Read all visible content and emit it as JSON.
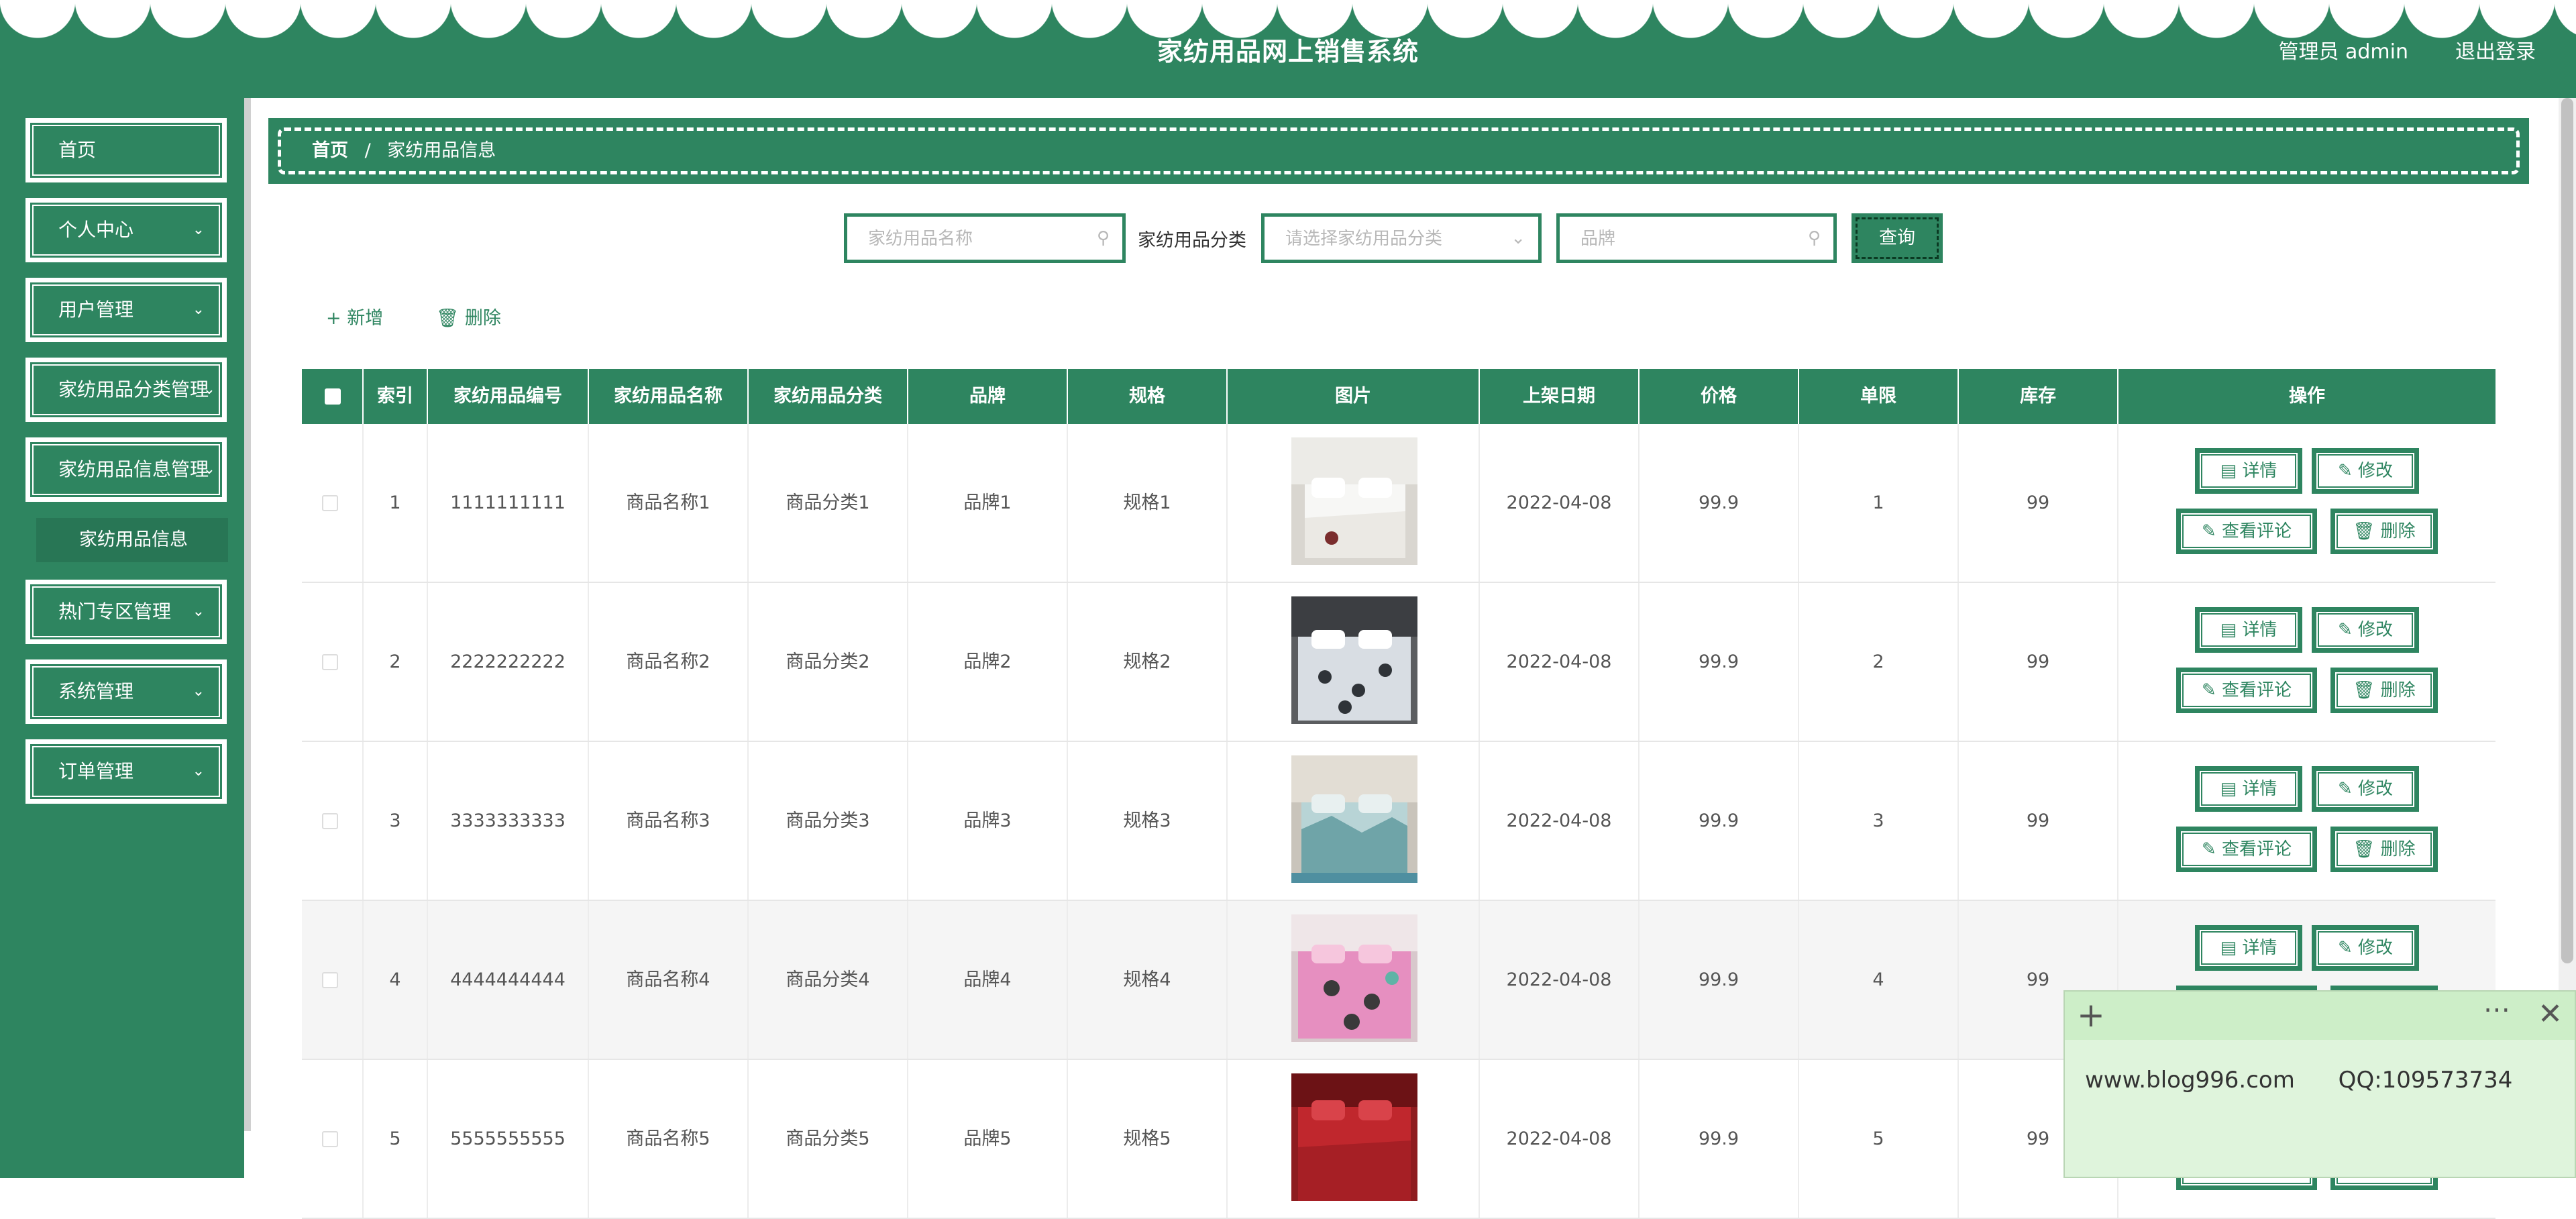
{
  "header": {
    "title": "家纺用品网上销售系统",
    "admin_label": "管理员 admin",
    "logout": "退出登录"
  },
  "sidebar": {
    "items": [
      {
        "label": "首页",
        "has_arrow": false
      },
      {
        "label": "个人中心",
        "has_arrow": true
      },
      {
        "label": "用户管理",
        "has_arrow": true
      },
      {
        "label": "家纺用品分类管理",
        "has_arrow": true
      },
      {
        "label": "家纺用品信息管理",
        "has_arrow": true
      },
      {
        "label": "热门专区管理",
        "has_arrow": true
      },
      {
        "label": "系统管理",
        "has_arrow": true
      },
      {
        "label": "订单管理",
        "has_arrow": true
      }
    ],
    "sub_item": "家纺用品信息"
  },
  "breadcrumb": {
    "home": "首页",
    "separator": "/",
    "current": "家纺用品信息"
  },
  "search": {
    "name_placeholder": "家纺用品名称",
    "category_label": "家纺用品分类",
    "category_placeholder": "请选择家纺用品分类",
    "brand_placeholder": "品牌",
    "query_button": "查询"
  },
  "actions": {
    "add": "新增",
    "delete": "删除"
  },
  "table": {
    "headers": [
      "索引",
      "家纺用品编号",
      "家纺用品名称",
      "家纺用品分类",
      "品牌",
      "规格",
      "图片",
      "上架日期",
      "价格",
      "单限",
      "库存",
      "操作"
    ],
    "rows": [
      {
        "index": "1",
        "code": "1111111111",
        "name": "商品名称1",
        "category": "商品分类1",
        "brand": "品牌1",
        "spec": "规格1",
        "date": "2022-04-08",
        "price": "99.9",
        "limit": "1",
        "stock": "99"
      },
      {
        "index": "2",
        "code": "2222222222",
        "name": "商品名称2",
        "category": "商品分类2",
        "brand": "品牌2",
        "spec": "规格2",
        "date": "2022-04-08",
        "price": "99.9",
        "limit": "2",
        "stock": "99"
      },
      {
        "index": "3",
        "code": "3333333333",
        "name": "商品名称3",
        "category": "商品分类3",
        "brand": "品牌3",
        "spec": "规格3",
        "date": "2022-04-08",
        "price": "99.9",
        "limit": "3",
        "stock": "99"
      },
      {
        "index": "4",
        "code": "4444444444",
        "name": "商品名称4",
        "category": "商品分类4",
        "brand": "品牌4",
        "spec": "规格4",
        "date": "2022-04-08",
        "price": "99.9",
        "limit": "4",
        "stock": "99"
      },
      {
        "index": "5",
        "code": "5555555555",
        "name": "商品名称5",
        "category": "商品分类5",
        "brand": "品牌5",
        "spec": "规格5",
        "date": "2022-04-08",
        "price": "99.9",
        "limit": "5",
        "stock": "99"
      }
    ],
    "ops": {
      "detail": "详情",
      "edit": "修改",
      "comments": "查看评论",
      "delete": "删除"
    }
  },
  "note": {
    "text": "www.blog996.com      QQ:109573734"
  },
  "colors": {
    "primary": "#2e8560",
    "sub_item_bg": "#287655",
    "note_bg": "#dff4dc"
  },
  "icons": [
    "search-icon",
    "chevron-down-icon",
    "plus-icon",
    "trash-icon",
    "document-icon",
    "pencil-icon",
    "close-icon",
    "more-icon"
  ]
}
